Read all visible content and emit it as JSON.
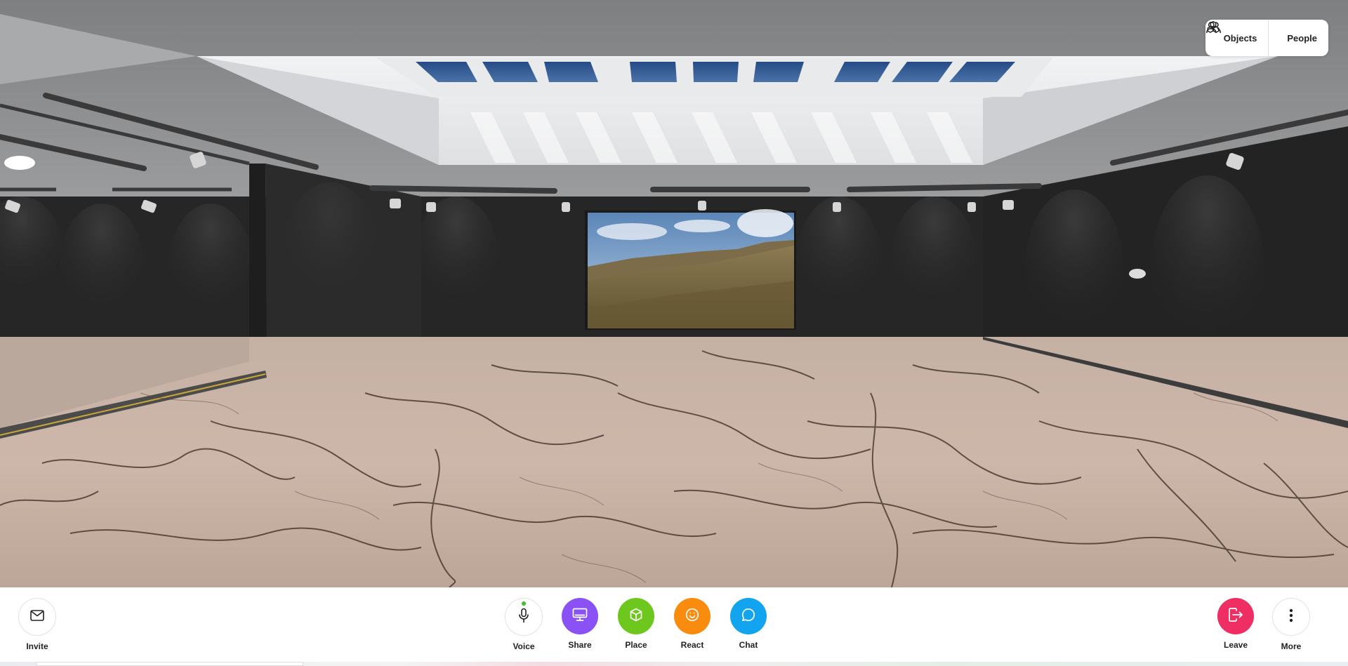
{
  "top_panel": {
    "objects_label": "Objects",
    "people_label": "People"
  },
  "toolbar": {
    "invite_label": "Invite",
    "voice_label": "Voice",
    "share_label": "Share",
    "place_label": "Place",
    "react_label": "React",
    "chat_label": "Chat",
    "leave_label": "Leave",
    "more_label": "More"
  },
  "colors": {
    "share": "#8a52f4",
    "place": "#6dc71c",
    "react": "#f98b0f",
    "chat": "#12a4ee",
    "leave": "#ef2f64",
    "voice_indicator": "#3cc12a"
  },
  "icons": {
    "objects": "cubes-icon",
    "people": "people-icon",
    "invite": "mail-icon",
    "voice": "microphone-icon",
    "share": "monitor-icon",
    "place": "cube-icon",
    "react": "smiley-icon",
    "chat": "chat-bubble-icon",
    "leave": "exit-icon",
    "more": "more-dots-icon"
  }
}
